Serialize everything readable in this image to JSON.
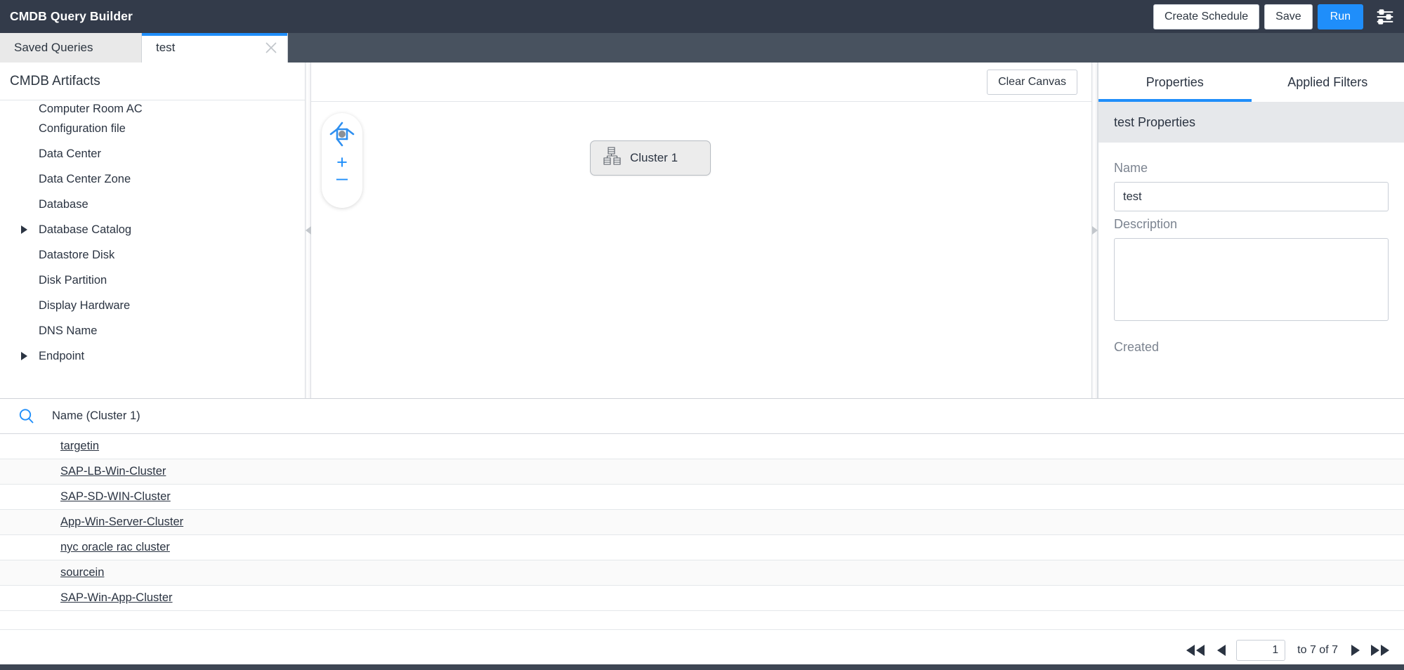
{
  "header": {
    "title": "CMDB Query Builder",
    "buttons": [
      {
        "label": "Create Schedule",
        "name": "create-schedule-button"
      },
      {
        "label": "Save",
        "name": "save-button"
      },
      {
        "label": "Run",
        "name": "run-button"
      }
    ],
    "settings_icon": "sliders-icon",
    "accent_color": "#1f8efa",
    "bar_color": "#333b4a"
  },
  "tabs": {
    "saved_queries": "Saved Queries",
    "active_tab": "test",
    "close_icon": "close-icon"
  },
  "tree": {
    "header": "CMDB Artifacts",
    "items": [
      {
        "label": "Computer Room AC",
        "expandable": false,
        "clipped": true
      },
      {
        "label": "Configuration file",
        "expandable": false
      },
      {
        "label": "Data Center",
        "expandable": false
      },
      {
        "label": "Data Center Zone",
        "expandable": false
      },
      {
        "label": "Database",
        "expandable": false
      },
      {
        "label": "Database Catalog",
        "expandable": true
      },
      {
        "label": "Datastore Disk",
        "expandable": false
      },
      {
        "label": "Disk Partition",
        "expandable": false
      },
      {
        "label": "Display Hardware",
        "expandable": false
      },
      {
        "label": "DNS Name",
        "expandable": false
      },
      {
        "label": "Endpoint",
        "expandable": true
      }
    ]
  },
  "canvas": {
    "clear_button": "Clear Canvas",
    "pan_icon": "pan-control-icon",
    "zoom_in": "+",
    "zoom_out": "–",
    "node": {
      "label": "Cluster 1",
      "icon": "cluster-icon"
    }
  },
  "properties": {
    "tab_properties": "Properties",
    "tab_applied_filters": "Applied Filters",
    "subheader": "test Properties",
    "name_label": "Name",
    "name_value": "test",
    "description_label": "Description",
    "description_value": "",
    "created_label": "Created"
  },
  "results": {
    "search_icon": "search-icon",
    "column_header": "Name (Cluster 1)",
    "rows": [
      "targetin",
      "SAP-LB-Win-Cluster",
      "SAP-SD-WIN-Cluster",
      "App-Win-Server-Cluster",
      "nyc oracle rac cluster",
      "sourcein",
      "SAP-Win-App-Cluster"
    ],
    "pagination": {
      "first_icon": "first-page-icon",
      "prev_icon": "previous-page-icon",
      "page_value": "1",
      "status": "to 7 of 7",
      "next_icon": "next-page-icon",
      "last_icon": "last-page-icon"
    }
  }
}
